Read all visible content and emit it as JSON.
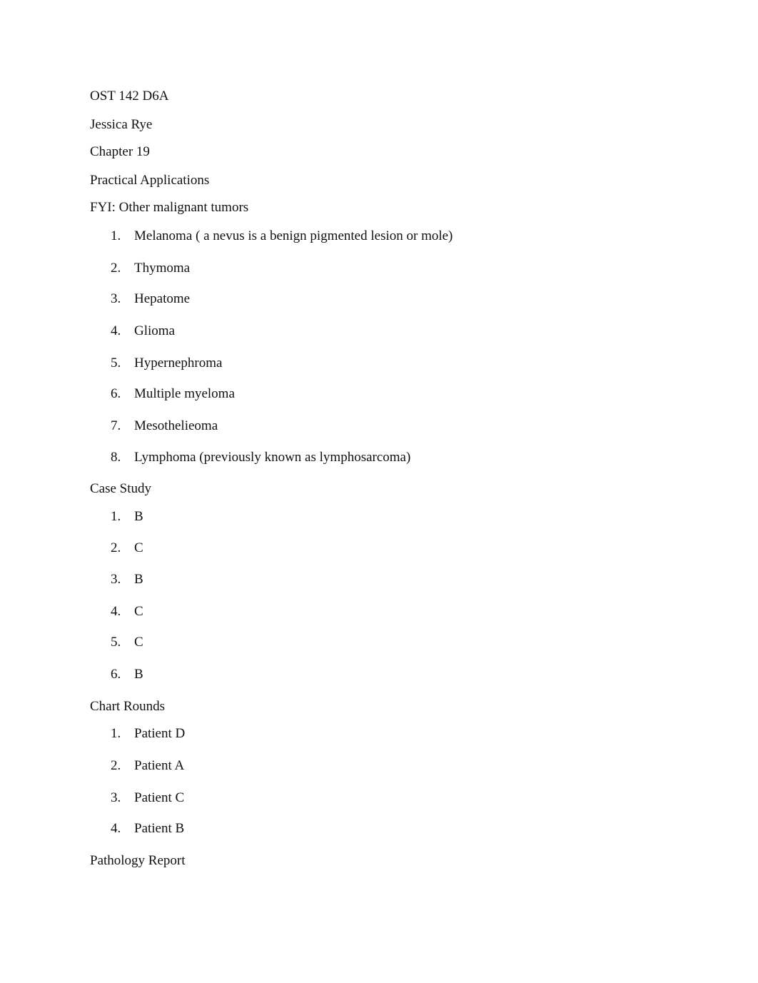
{
  "header": {
    "course": "OST 142 D6A",
    "name": "Jessica Rye",
    "chapter": "Chapter 19",
    "section": "Practical Applications"
  },
  "fyi": {
    "heading": "FYI: Other malignant tumors",
    "items": [
      {
        "num": "1.",
        "text": "Melanoma ( a nevus is a benign pigmented lesion or mole)"
      },
      {
        "num": "2.",
        "text": "Thymoma"
      },
      {
        "num": "3.",
        "text": "Hepatome"
      },
      {
        "num": "4.",
        "text": "Glioma"
      },
      {
        "num": "5.",
        "text": "Hypernephroma"
      },
      {
        "num": "6.",
        "text": "Multiple myeloma"
      },
      {
        "num": "7.",
        "text": "Mesothelieoma"
      },
      {
        "num": "8.",
        "text": "Lymphoma (previously known as lymphosarcoma)"
      }
    ]
  },
  "case_study": {
    "heading": "Case Study",
    "items": [
      {
        "num": "1.",
        "text": "B"
      },
      {
        "num": "2.",
        "text": "C"
      },
      {
        "num": "3.",
        "text": "B"
      },
      {
        "num": "4.",
        "text": "C"
      },
      {
        "num": "5.",
        "text": "C"
      },
      {
        "num": "6.",
        "text": "B"
      }
    ]
  },
  "chart_rounds": {
    "heading": "Chart Rounds",
    "items": [
      {
        "num": "1.",
        "text": "Patient D"
      },
      {
        "num": "2.",
        "text": "Patient A"
      },
      {
        "num": "3.",
        "text": "Patient C"
      },
      {
        "num": "4.",
        "text": "Patient B"
      }
    ]
  },
  "pathology_report": {
    "heading": "Pathology Report"
  }
}
